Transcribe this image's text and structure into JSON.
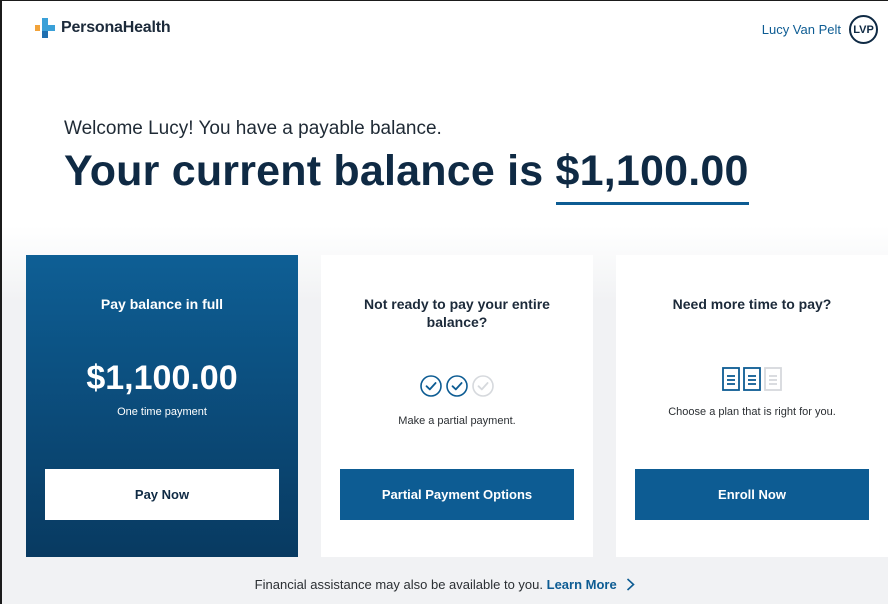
{
  "header": {
    "logo_text": "PersonaHealth",
    "user_name": "Lucy Van Pelt",
    "user_initials": "LVP"
  },
  "hero": {
    "welcome": "Welcome Lucy! You have a payable balance.",
    "heading_prefix": "Your current balance is",
    "balance": "$1,100.00"
  },
  "cards": {
    "full": {
      "title": "Pay balance in full",
      "amount": "$1,100.00",
      "caption": "One time payment",
      "button": "Pay Now"
    },
    "partial": {
      "title": "Not ready to pay your entire balance?",
      "caption": "Make a partial payment.",
      "button": "Partial Payment Options",
      "icons": [
        "check-circle-icon",
        "check-circle-icon",
        "check-circle-faded-icon"
      ]
    },
    "plan": {
      "title": "Need more time to pay?",
      "caption": "Choose a plan that is right for you.",
      "button": "Enroll Now",
      "icons": [
        "document-icon",
        "document-icon",
        "document-faded-icon"
      ]
    }
  },
  "footer": {
    "text": "Financial assistance may also be available to you.",
    "link": "Learn More"
  },
  "colors": {
    "primary": "#0d5c93",
    "navy": "#0f2a44",
    "card_full_bg": "#0b4a78",
    "logo_orange": "#f2a33a",
    "logo_blue": "#3aa0d8"
  }
}
